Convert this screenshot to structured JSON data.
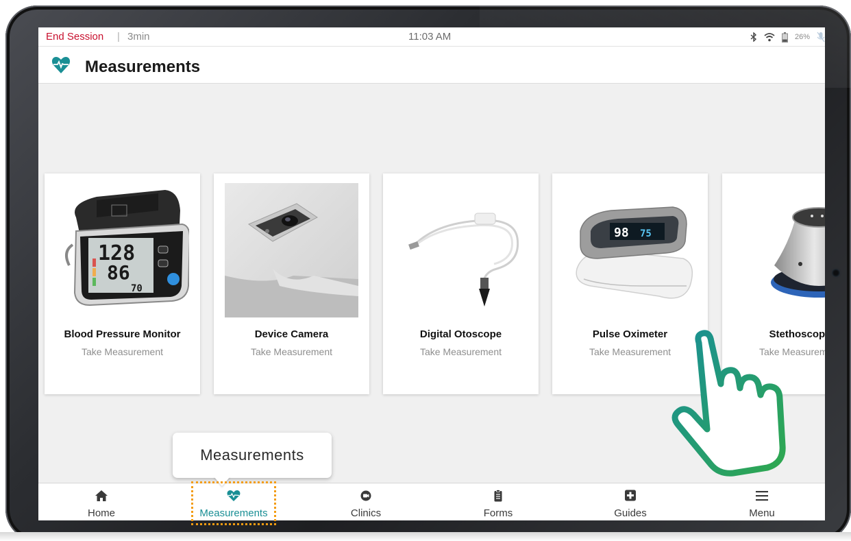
{
  "status_bar": {
    "end_session": "End Session",
    "separator": "|",
    "session_time": "3min",
    "clock": "11:03 AM",
    "battery": "26%",
    "icons": [
      "bluetooth-icon",
      "wifi-icon",
      "battery-icon",
      "mic-muted-icon"
    ]
  },
  "header": {
    "icon": "heart-pulse-icon",
    "title": "Measurements"
  },
  "cards": [
    {
      "title": "Blood Pressure Monitor",
      "subtitle": "Take Measurement"
    },
    {
      "title": "Device Camera",
      "subtitle": "Take Measurement"
    },
    {
      "title": "Digital Otoscope",
      "subtitle": "Take Measurement"
    },
    {
      "title": "Pulse Oximeter",
      "subtitle": "Take Measurement"
    },
    {
      "title": "Stethoscope",
      "subtitle": "Take Measurement"
    }
  ],
  "bp_display": {
    "sys": "128",
    "dia": "86",
    "pul": "70"
  },
  "oximeter_display": {
    "spo2": "98",
    "pulse": "75"
  },
  "bottom_nav": {
    "items": [
      {
        "label": "Home",
        "icon": "home-icon"
      },
      {
        "label": "Measurements",
        "icon": "heart-pulse-icon"
      },
      {
        "label": "Clinics",
        "icon": "video-icon"
      },
      {
        "label": "Forms",
        "icon": "clipboard-icon"
      },
      {
        "label": "Guides",
        "icon": "medical-plus-icon"
      },
      {
        "label": "Menu",
        "icon": "hamburger-icon"
      }
    ],
    "active": "Measurements"
  },
  "tooltip": {
    "text": "Measurements"
  },
  "colors": {
    "accent": "#1a8f95",
    "end_session": "#c8102e",
    "highlight": "#f39c12"
  }
}
